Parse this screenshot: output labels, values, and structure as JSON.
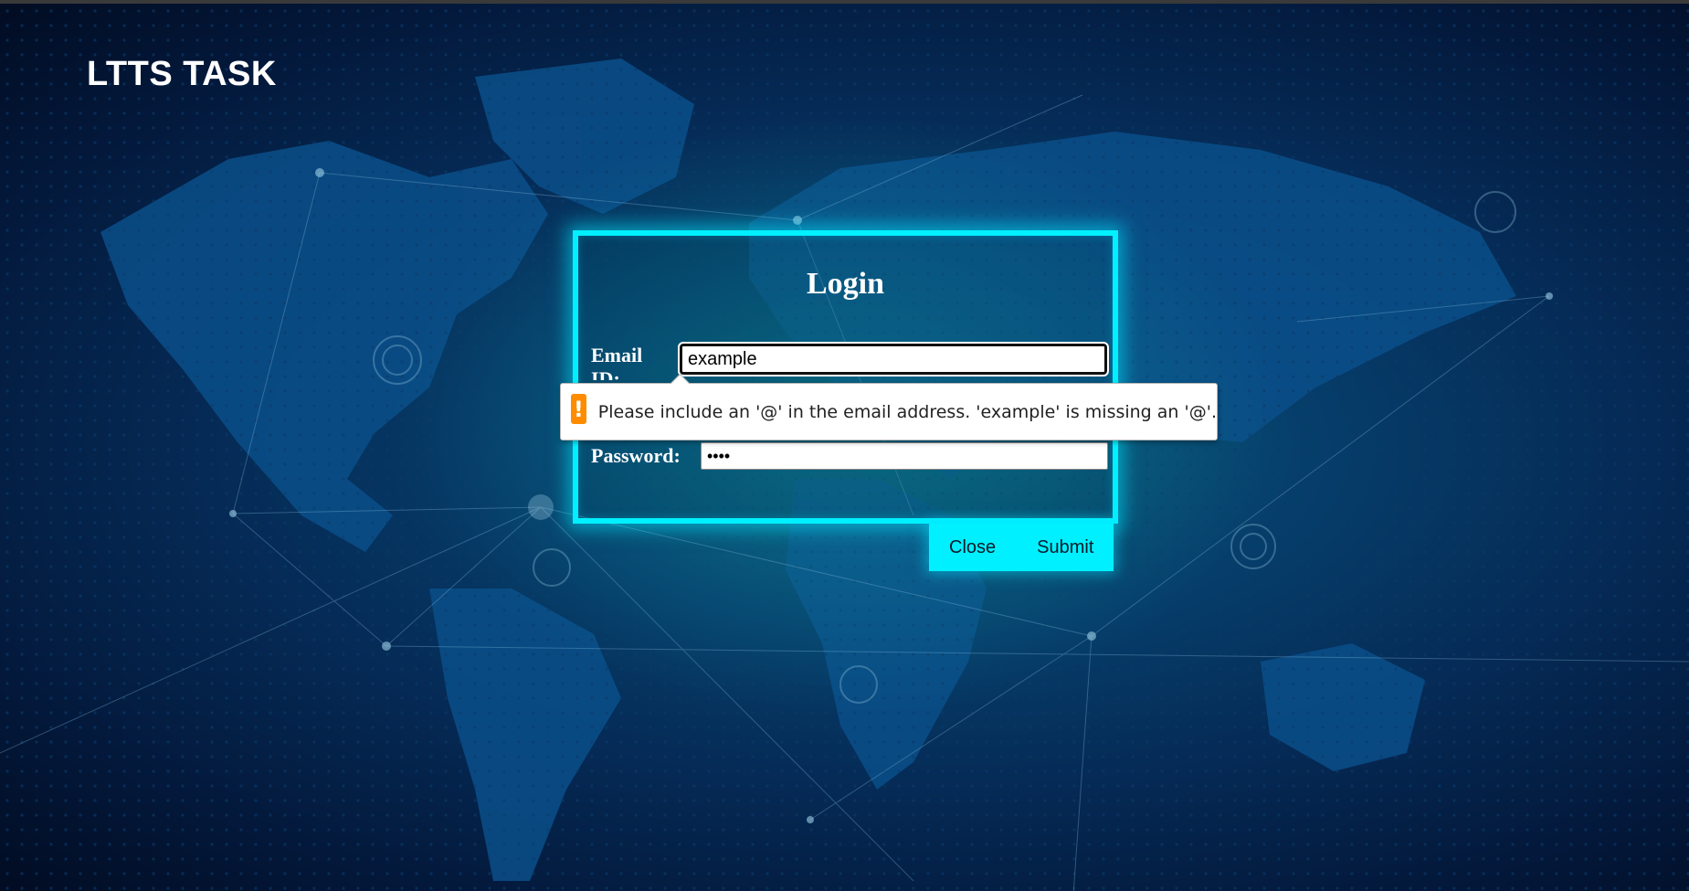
{
  "brand": {
    "title": "LTTS TASK"
  },
  "login": {
    "title": "Login",
    "email_label": "Email ID:",
    "email_value": "example",
    "password_label": "Password:",
    "password_value": "••••",
    "close_label": "Close",
    "submit_label": "Submit"
  },
  "validation": {
    "icon": "warning-icon",
    "icon_glyph": "!",
    "message": "Please include an '@' in the email address. 'example' is missing an '@'."
  },
  "colors": {
    "accent": "#00f0ff",
    "warning": "#ff8c00",
    "background": "#052a55"
  }
}
